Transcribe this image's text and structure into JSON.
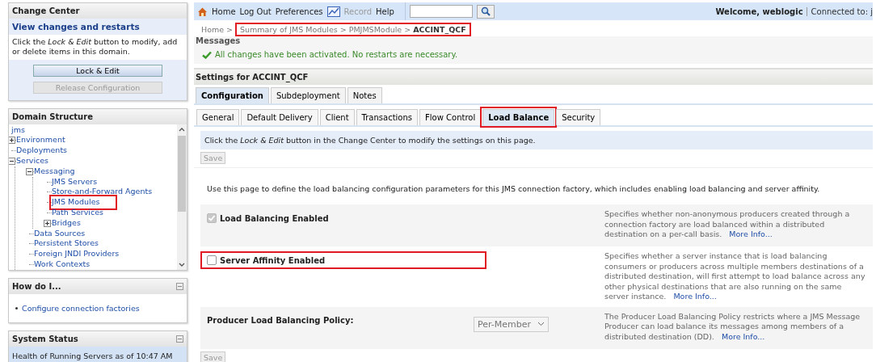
{
  "change_center": {
    "title": "Change Center",
    "link": "View changes and restarts",
    "text": "Click the *Lock & Edit* button to modify, add or delete items in this domain.",
    "buttons": [
      {
        "label": "Lock & Edit",
        "disabled": false
      },
      {
        "label": "Release Configuration",
        "disabled": true
      }
    ]
  },
  "domain_structure": {
    "title": "Domain Structure",
    "root": "jms",
    "tree": [
      {
        "label": "Environment",
        "expanded": false
      },
      {
        "label": "Deployments"
      },
      {
        "label": "Services",
        "expanded": true,
        "children": [
          {
            "label": "Messaging",
            "expanded": true,
            "children": [
              {
                "label": "JMS Servers"
              },
              {
                "label": "Store-and-Forward Agents"
              },
              {
                "label": "JMS Modules",
                "highlighted": true
              },
              {
                "label": "Path Services"
              },
              {
                "label": "Bridges",
                "expanded": false
              }
            ]
          },
          {
            "label": "Data Sources"
          },
          {
            "label": "Persistent Stores"
          },
          {
            "label": "Foreign JNDI Providers"
          },
          {
            "label": "Work Contexts"
          }
        ]
      }
    ]
  },
  "how_do_i": {
    "title": "How do I...",
    "links": [
      "Configure connection factories"
    ]
  },
  "system_status": {
    "title": "System Status",
    "text": "Health of Running Servers as of  10:47 AM"
  },
  "toolbar": {
    "links": [
      {
        "kind": "home",
        "label": "Home",
        "disabled": false
      },
      {
        "kind": "text",
        "label": "Log Out",
        "disabled": false
      },
      {
        "kind": "text",
        "label": "Preferences",
        "disabled": false
      },
      {
        "kind": "record",
        "label": "Record",
        "disabled": true
      },
      {
        "kind": "text",
        "label": "Help",
        "disabled": false
      }
    ],
    "welcome": "Welcome, weblogic",
    "connected": "Connected to: j"
  },
  "breadcrumb": [
    {
      "label": "Home >",
      "highlighted": false,
      "current": false
    },
    {
      "label": "Summary of JMS Modules >",
      "highlighted": true,
      "current": false
    },
    {
      "label": "PMJMSModule >",
      "highlighted": true,
      "current": false
    },
    {
      "label": "ACCINT_QCF",
      "highlighted": true,
      "current": true
    }
  ],
  "messages": {
    "title": "Messages",
    "text": "All changes have been activated. No restarts are necessary."
  },
  "settings_title": "Settings for ACCINT_QCF",
  "tabs": [
    {
      "label": "Configuration",
      "selected": true
    },
    {
      "label": "Subdeployment",
      "selected": false
    },
    {
      "label": "Notes",
      "selected": false
    }
  ],
  "subtabs": [
    {
      "label": "General",
      "selected": false,
      "highlighted": false
    },
    {
      "label": "Default Delivery",
      "selected": false,
      "highlighted": false
    },
    {
      "label": "Client",
      "selected": false,
      "highlighted": false
    },
    {
      "label": "Transactions",
      "selected": false,
      "highlighted": false
    },
    {
      "label": "Flow Control",
      "selected": false,
      "highlighted": false
    },
    {
      "label": "Load Balance",
      "selected": true,
      "highlighted": true
    },
    {
      "label": "Security",
      "selected": false,
      "highlighted": false
    }
  ],
  "info": "Click the *Lock & Edit* button in the Change Center to modify the settings on this page.",
  "save_buttons": [
    {
      "label": "Save",
      "disabled": true
    },
    {
      "label": "Save",
      "disabled": true
    }
  ],
  "description": "Use this page to define the load balancing configuration parameters for this JMS connection factory, which includes enabling load balancing and server affinity.",
  "settings": [
    {
      "kind": "checkbox",
      "label": "Load Balancing Enabled",
      "checked": true,
      "disabled": true,
      "highlighted": false,
      "help": "Specifies whether non-anonymous producers created through a connection factory are load balanced within a distributed destination on a per-call basis.",
      "more": "More Info..."
    },
    {
      "kind": "checkbox",
      "label": "Server Affinity Enabled",
      "checked": false,
      "disabled": false,
      "highlighted": true,
      "help": "Specifies whether a server instance that is load balancing consumers or producers across multiple members destinations of a distributed destination, will first attempt to load balance across any other physical destinations that are also running on the same server instance.",
      "more": "More Info..."
    },
    {
      "kind": "select",
      "label": "Producer Load Balancing Policy:",
      "value": "Per-Member",
      "disabled": true,
      "highlighted": false,
      "help": "The Producer Load Balancing Policy restricts where a JMS Message Producer can load balance its messages among members of a distributed destination (DD).",
      "more": "More Info..."
    }
  ]
}
